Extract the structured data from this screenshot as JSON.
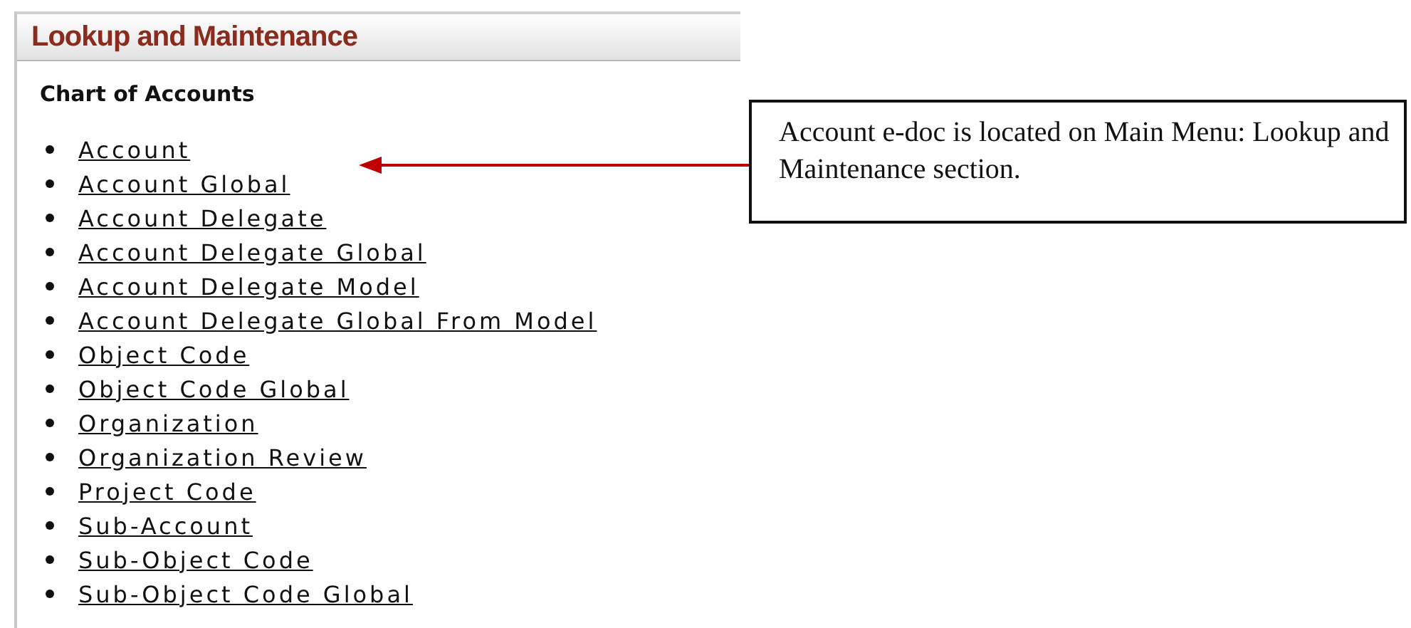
{
  "panel": {
    "title": "Lookup and Maintenance",
    "section": "Chart of Accounts",
    "links": [
      "Account",
      "Account Global",
      "Account Delegate",
      "Account Delegate Global",
      "Account Delegate Model",
      "Account Delegate Global From Model",
      "Object Code",
      "Object Code Global",
      "Organization",
      "Organization Review",
      "Project Code",
      "Sub-Account",
      "Sub-Object Code",
      "Sub-Object Code Global"
    ]
  },
  "callout": {
    "text": "Account e-doc is located on Main Menu: Lookup and Maintenance section."
  }
}
